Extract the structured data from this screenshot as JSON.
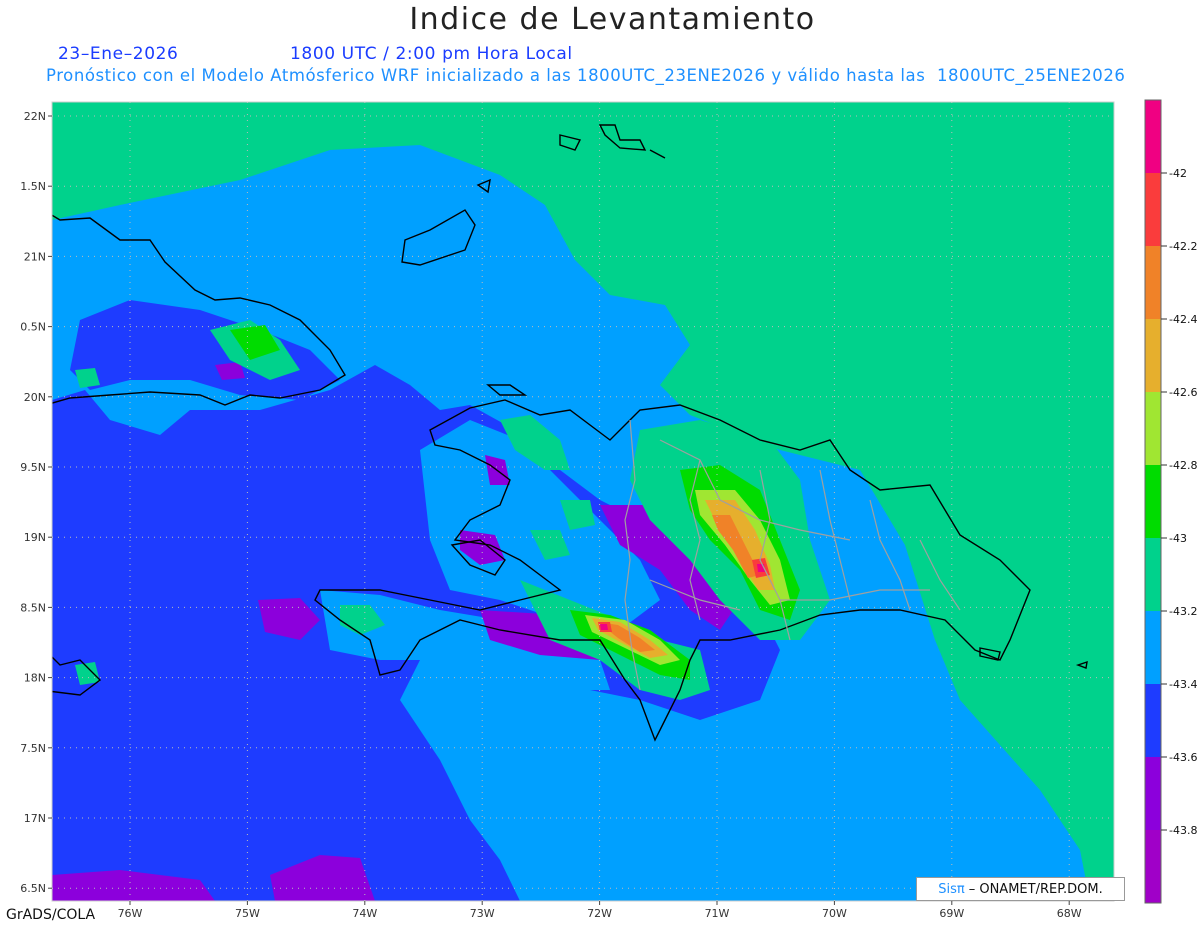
{
  "header": {
    "title": "Indice de Levantamiento",
    "date": "23–Ene–2026",
    "time": "1800 UTC / 2:00 pm Hora Local",
    "forecast": "Pronóstico con el Modelo Atmósferico WRF inicializado a las 1800UTC_23ENE2026 y válido hasta las  1800UTC_25ENE2026"
  },
  "map": {
    "lat_labels": [
      "22N",
      "1.5N",
      "21N",
      "0.5N",
      "20N",
      "9.5N",
      "19N",
      "8.5N",
      "18N",
      "7.5N",
      "17N",
      "6.5N"
    ],
    "lon_labels": [
      "76W",
      "75W",
      "74W",
      "73W",
      "72W",
      "71W",
      "70W",
      "69W",
      "68W"
    ],
    "colors": {
      "ocean_green": "#00d28c",
      "light_blue": "#00a0ff",
      "blue": "#1e3cff",
      "blue_violet": "#5a1edc",
      "purple": "#8c00dc",
      "green": "#00dc00",
      "light_green": "#a0e632",
      "orange_yellow": "#e6af2d",
      "orange": "#f08228",
      "red": "#fa3c3c",
      "magenta": "#f00082"
    }
  },
  "colorbar": {
    "labels": [
      "-42",
      "-42.2",
      "-42.4",
      "-42.6",
      "-42.8",
      "-43",
      "-43.2",
      "-43.4",
      "-43.6",
      "-43.8"
    ],
    "colors": [
      "#f00082",
      "#fa3c3c",
      "#f08228",
      "#e6af2d",
      "#a0e632",
      "#00dc00",
      "#00d28c",
      "#00a0ff",
      "#1e3cff",
      "#8c00dc",
      "#a000c8"
    ]
  },
  "credit": {
    "brand": "Sisπ",
    "text": "– ONAMET/REP.DOM."
  },
  "footer": "GrADS/COLA"
}
